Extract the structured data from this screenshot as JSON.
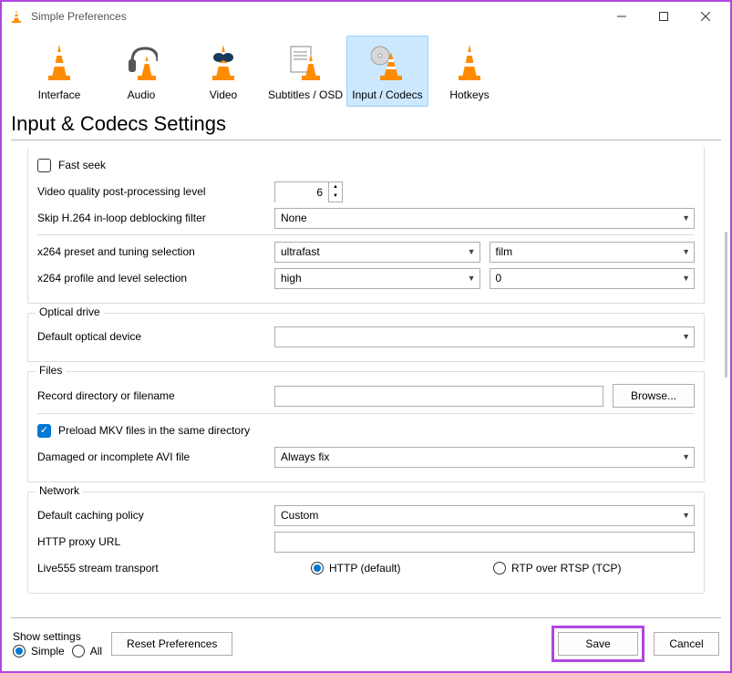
{
  "window": {
    "title": "Simple Preferences"
  },
  "toolbar": {
    "items": [
      {
        "label": "Interface"
      },
      {
        "label": "Audio"
      },
      {
        "label": "Video"
      },
      {
        "label": "Subtitles / OSD"
      },
      {
        "label": "Input / Codecs"
      },
      {
        "label": "Hotkeys"
      }
    ],
    "selected": 4
  },
  "section_title": "Input & Codecs Settings",
  "codecs": {
    "fast_seek_label": "Fast seek",
    "postproc_label": "Video quality post-processing level",
    "postproc_value": "6",
    "skip_deblock_label": "Skip H.264 in-loop deblocking filter",
    "skip_deblock_value": "None",
    "x264_preset_label": "x264 preset and tuning selection",
    "x264_preset_value": "ultrafast",
    "x264_tune_value": "film",
    "x264_profile_label": "x264 profile and level selection",
    "x264_profile_value": "high",
    "x264_level_value": "0"
  },
  "optical": {
    "group_title": "Optical drive",
    "default_device_label": "Default optical device",
    "default_device_value": ""
  },
  "files": {
    "group_title": "Files",
    "record_dir_label": "Record directory or filename",
    "record_dir_value": "",
    "browse_label": "Browse...",
    "preload_mkv_label": "Preload MKV files in the same directory",
    "avi_label": "Damaged or incomplete AVI file",
    "avi_value": "Always fix"
  },
  "network": {
    "group_title": "Network",
    "caching_label": "Default caching policy",
    "caching_value": "Custom",
    "proxy_label": "HTTP proxy URL",
    "proxy_value": "",
    "live555_label": "Live555 stream transport",
    "live555_http": "HTTP (default)",
    "live555_rtp": "RTP over RTSP (TCP)"
  },
  "footer": {
    "show_settings_label": "Show settings",
    "simple_label": "Simple",
    "all_label": "All",
    "reset_label": "Reset Preferences",
    "save_label": "Save",
    "cancel_label": "Cancel"
  }
}
